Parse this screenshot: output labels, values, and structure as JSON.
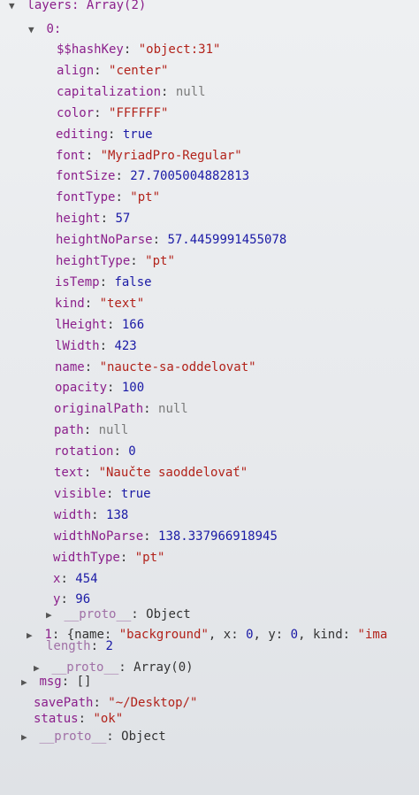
{
  "root": {
    "label": "layers: Array(2)"
  },
  "item0": {
    "label": "0:"
  },
  "props": [
    {
      "key": "$$hashKey",
      "value": "\"object:31\"",
      "type": "str"
    },
    {
      "key": "align",
      "value": "\"center\"",
      "type": "str"
    },
    {
      "key": "capitalization",
      "value": "null",
      "type": "nul"
    },
    {
      "key": "color",
      "value": "\"FFFFFF\"",
      "type": "str"
    },
    {
      "key": "editing",
      "value": "true",
      "type": "kw"
    },
    {
      "key": "font",
      "value": "\"MyriadPro-Regular\"",
      "type": "str"
    },
    {
      "key": "fontSize",
      "value": "27.7005004882813",
      "type": "num"
    },
    {
      "key": "fontType",
      "value": "\"pt\"",
      "type": "str"
    },
    {
      "key": "height",
      "value": "57",
      "type": "num"
    },
    {
      "key": "heightNoParse",
      "value": "57.4459991455078",
      "type": "num"
    },
    {
      "key": "heightType",
      "value": "\"pt\"",
      "type": "str"
    },
    {
      "key": "isTemp",
      "value": "false",
      "type": "kw"
    },
    {
      "key": "kind",
      "value": "\"text\"",
      "type": "str"
    },
    {
      "key": "lHeight",
      "value": "166",
      "type": "num"
    },
    {
      "key": "lWidth",
      "value": "423",
      "type": "num"
    },
    {
      "key": "name",
      "value": "\"naucte-sa-oddelovat\"",
      "type": "str"
    },
    {
      "key": "opacity",
      "value": "100",
      "type": "num"
    },
    {
      "key": "originalPath",
      "value": "null",
      "type": "nul"
    },
    {
      "key": "path",
      "value": "null",
      "type": "nul"
    },
    {
      "key": "rotation",
      "value": "0",
      "type": "num"
    },
    {
      "key": "text",
      "value": "\"Naučte saoddelovať\"",
      "type": "str"
    },
    {
      "key": "visible",
      "value": "true",
      "type": "kw"
    },
    {
      "key": "width",
      "value": "138",
      "type": "num"
    },
    {
      "key": "widthNoParse",
      "value": "138.337966918945",
      "type": "num"
    },
    {
      "key": "widthType",
      "value": "\"pt\"",
      "type": "str"
    },
    {
      "key": "x",
      "value": "454",
      "type": "num"
    },
    {
      "key": "y",
      "value": "96",
      "type": "num"
    }
  ],
  "proto_object": {
    "key": "__proto__",
    "value": "Object"
  },
  "item1": {
    "index": "1",
    "summary_open": "{name: ",
    "name_value": "\"background\"",
    "rest1": ", x: ",
    "x_value": "0",
    "rest2": ", y: ",
    "y_value": "0",
    "rest3": ", kind: ",
    "kind_value": "\"ima"
  },
  "length": {
    "key": "length",
    "value": "2"
  },
  "proto_array": {
    "key": "__proto__",
    "value": "Array(0)"
  },
  "msg": {
    "key": "msg",
    "value": "[]"
  },
  "savePath": {
    "key": "savePath",
    "value": "\"~/Desktop/\""
  },
  "status": {
    "key": "status",
    "value": "\"ok\""
  },
  "proto_root": {
    "key": "__proto__",
    "value": "Object"
  }
}
